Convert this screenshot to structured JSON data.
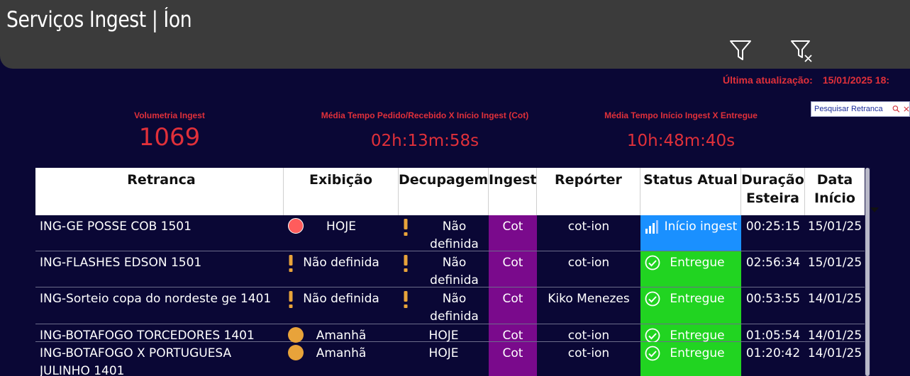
{
  "header": {
    "title": "Serviços Ingest | Íon",
    "filter_icon": "filter-icon",
    "clear_filter_icon": "clear-filter-icon"
  },
  "last_update": {
    "label": "Última atualização:",
    "value": "15/01/2025 18:"
  },
  "kpis": [
    {
      "label": "Volumetria Ingest",
      "value": "1069"
    },
    {
      "label": "Média Tempo Pedido/Recebido X Início Ingest (Cot)",
      "value": "02h:13m:58s"
    },
    {
      "label": "Média Tempo Início Ingest X Entregue",
      "value": "10h:48m:40s"
    }
  ],
  "search": {
    "placeholder": "Pesquisar Retranca",
    "icon": "search-icon",
    "clear_icon": "close-icon"
  },
  "colors": {
    "red": "#ff5c5c",
    "orange": "#e8a33a",
    "blue": "#1a90ff",
    "green": "#21d421",
    "purple": "#7a0a8c",
    "accent": "#e0303a"
  },
  "table": {
    "columns": [
      "Retranca",
      "Exibição",
      "Decupagem",
      "Ingest",
      "Repórter",
      "Status Atual",
      "Duração Esteira",
      "Data Início"
    ],
    "sort_indicator": "sort-descending-icon",
    "rows": [
      {
        "retranca": "ING-GE POSSE COB 1501",
        "exibicao": "HOJE",
        "exib_ind": "red-dot",
        "decupagem": "Não definida",
        "dec_ind": "exclamation",
        "ingest": "Cot",
        "reporter": "cot-ion",
        "status": "Início ingest",
        "status_icon": "signal-bars-icon",
        "status_color": "blue",
        "duracao": "00:25:15",
        "data": "15/01/25"
      },
      {
        "retranca": "ING-FLASHES EDSON 1501",
        "exibicao": "Não definida",
        "exib_ind": "exclamation",
        "decupagem": "Não definida",
        "dec_ind": "exclamation",
        "ingest": "Cot",
        "reporter": "cot-ion",
        "status": "Entregue",
        "status_icon": "check-circle-icon",
        "status_color": "green",
        "duracao": "02:56:34",
        "data": "15/01/25"
      },
      {
        "retranca": "ING-Sorteio copa do nordeste ge 1401",
        "exibicao": "Não definida",
        "exib_ind": "exclamation",
        "decupagem": "Não definida",
        "dec_ind": "exclamation",
        "ingest": "Cot",
        "reporter": "Kiko Menezes",
        "status": "Entregue",
        "status_icon": "check-circle-icon",
        "status_color": "green",
        "duracao": "00:53:55",
        "data": "14/01/25"
      },
      {
        "retranca": "ING-BOTAFOGO TORCEDORES 1401",
        "exibicao": "Amanhã",
        "exib_ind": "orange-dot",
        "decupagem": "HOJE",
        "dec_ind": "",
        "ingest": "Cot",
        "reporter": "cot-ion",
        "status": "Entregue",
        "status_icon": "check-circle-icon",
        "status_color": "green",
        "duracao": "01:05:54",
        "data": "14/01/25"
      },
      {
        "retranca": "ING-BOTAFOGO X PORTUGUESA JULINHO 1401",
        "exibicao": "Amanhã",
        "exib_ind": "orange-dot",
        "decupagem": "HOJE",
        "dec_ind": "",
        "ingest": "Cot",
        "reporter": "cot-ion",
        "status": "Entregue",
        "status_icon": "check-circle-icon",
        "status_color": "green",
        "duracao": "01:20:42",
        "data": "14/01/25"
      }
    ]
  }
}
